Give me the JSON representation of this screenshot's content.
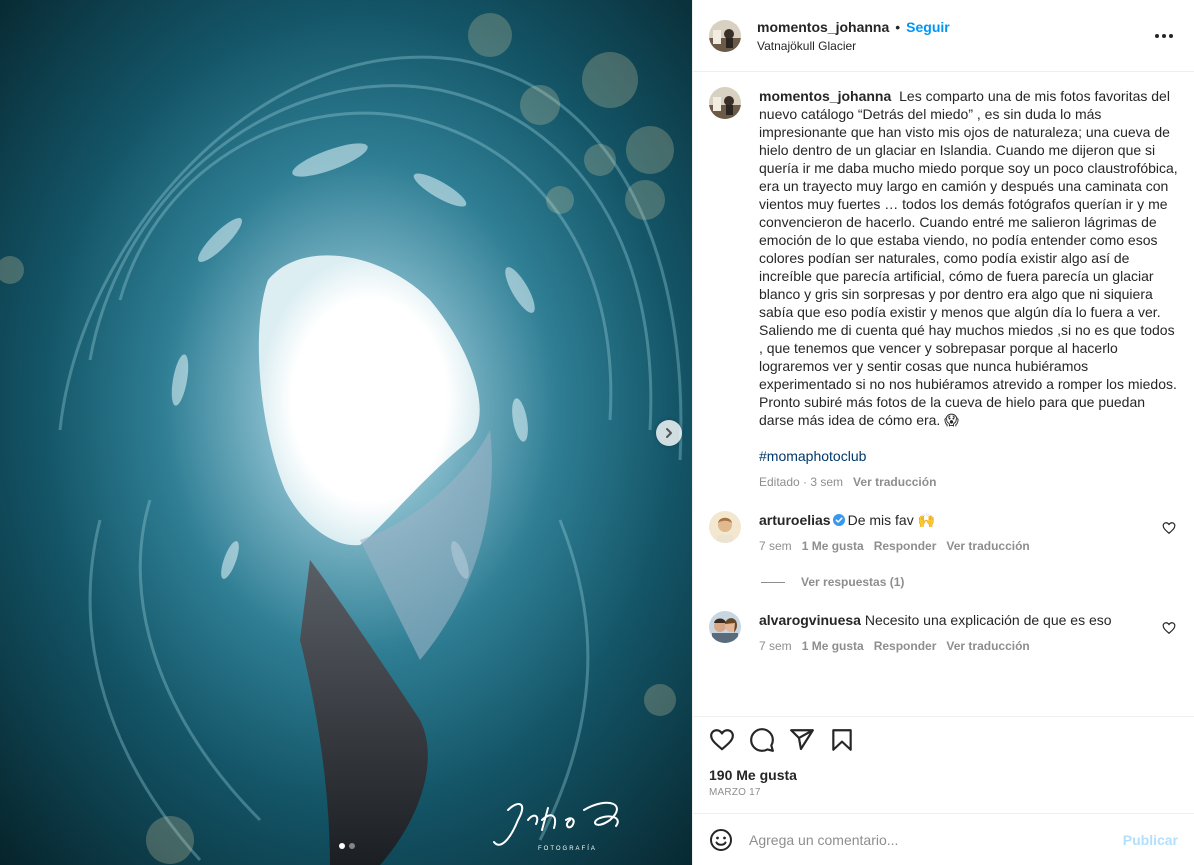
{
  "post": {
    "username": "momentos_johanna",
    "separator": "•",
    "follow_label": "Seguir",
    "location": "Vatnajökull Glacier",
    "more_icon": "more-horizontal-icon",
    "watermark_name": "Johanna Elias",
    "watermark_sub": "FOTOGRAFÍA"
  },
  "caption": {
    "username": "momentos_johanna",
    "text": "Les comparto una de mis fotos favoritas del nuevo catálogo “Detrás del miedo” , es sin duda lo más impresionante que han visto mis ojos de naturaleza; una cueva de hielo dentro de un glaciar en Islandia. Cuando me dijeron que si quería ir me daba mucho miedo porque soy un poco claustrofóbica, era un trayecto muy largo en camión y después una caminata con vientos muy fuertes … todos los demás fotógrafos querían ir y me convencieron de hacerlo. Cuando entré me salieron lágrimas de emoción de lo que estaba viendo, no podía entender como esos colores podían ser naturales, como podía existir algo así de increíble que parecía artificial, cómo de fuera parecía un glaciar blanco y gris sin sorpresas y por dentro era algo que ni siquiera sabía que eso podía existir y menos que algún día lo fuera a ver.\nSaliendo me di cuenta qué hay muchos miedos ,si no es que todos , que tenemos que vencer y sobrepasar porque al hacerlo lograremos ver y sentir cosas que nunca hubiéramos experimentado si no nos hubiéramos atrevido a romper los miedos.\nPronto subiré más fotos de la cueva de hielo para que puedan darse más idea de cómo era. 😱",
    "hashtag": "#momaphotoclub",
    "edited": "Editado · 3 sem",
    "translate": "Ver traducción"
  },
  "comments": [
    {
      "username": "arturoelias",
      "verified": true,
      "text": "De mis fav 🙌",
      "time": "7 sem",
      "likes": "1 Me gusta",
      "reply": "Responder",
      "translate": "Ver traducción",
      "view_replies": "Ver respuestas (1)"
    },
    {
      "username": "alvarogvinuesa",
      "verified": false,
      "text": "Necesito una explicación de que es eso",
      "time": "7 sem",
      "likes": "1 Me gusta",
      "reply": "Responder",
      "translate": "Ver traducción"
    }
  ],
  "stats": {
    "likes": "190 Me gusta",
    "date": "MARZO 17"
  },
  "add_comment": {
    "placeholder": "Agrega un comentario...",
    "post_label": "Publicar"
  },
  "carousel": {
    "current": 1,
    "total": 2
  },
  "colors": {
    "accent": "#0095f6",
    "post_disabled": "#b2dffc",
    "secondary_text": "#8e8e8e",
    "hashtag": "#00376b",
    "verified": "#3897f0"
  }
}
